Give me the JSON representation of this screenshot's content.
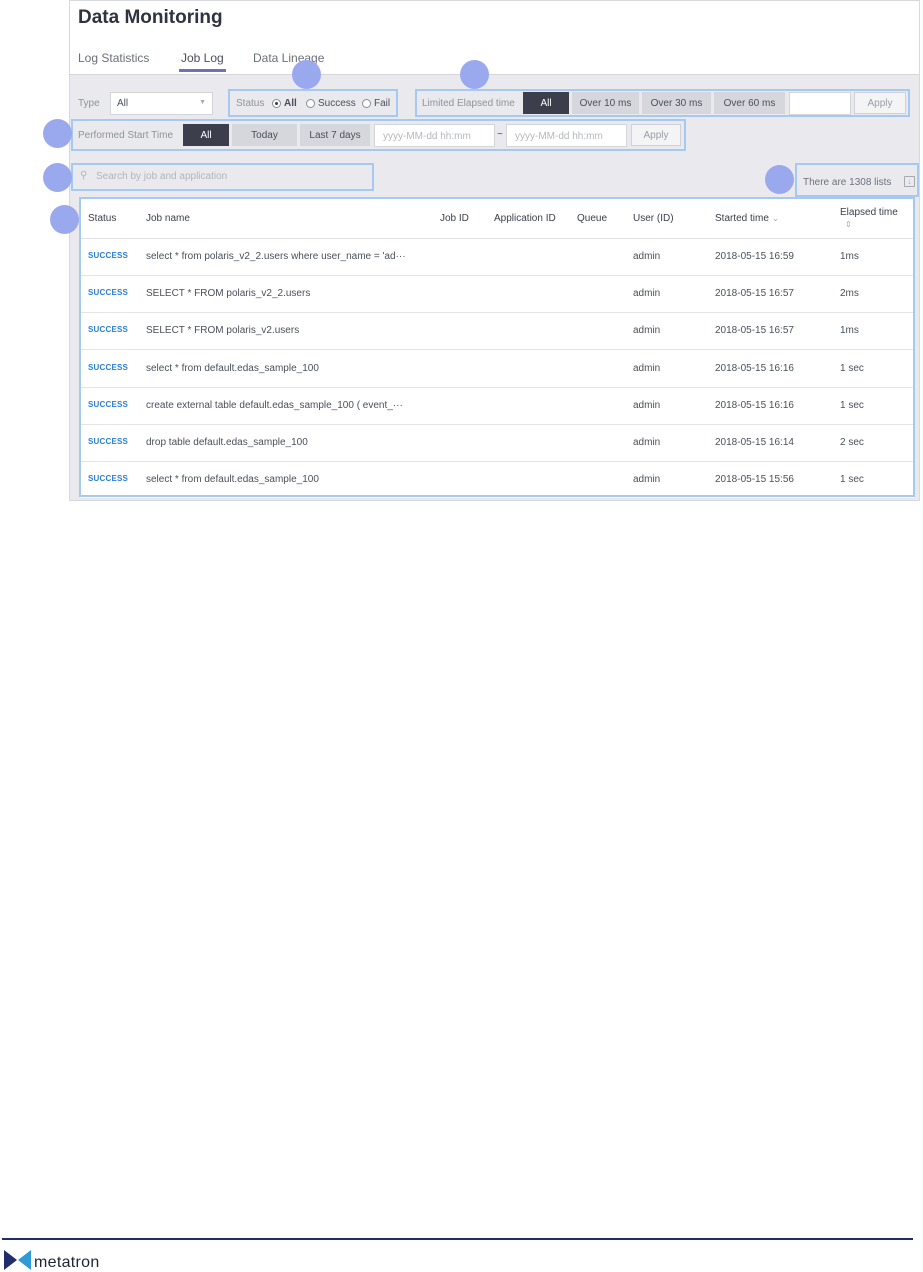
{
  "app": {
    "title": "Data Monitoring"
  },
  "tabs": [
    {
      "label": "Log Statistics",
      "active": false
    },
    {
      "label": "Job Log",
      "active": true
    },
    {
      "label": "Data Lineage",
      "active": false
    }
  ],
  "filters": {
    "type": {
      "label": "Type",
      "value": "All"
    },
    "status": {
      "label": "Status",
      "options": [
        {
          "label": "All",
          "selected": true
        },
        {
          "label": "Success",
          "selected": false
        },
        {
          "label": "Fail",
          "selected": false
        }
      ]
    },
    "elapsed": {
      "label": "Limited Elapsed time",
      "buttons": [
        "All",
        "Over 10 ms",
        "Over 30 ms",
        "Over 60 ms"
      ],
      "selected": "All",
      "custom_value": "",
      "apply_label": "Apply"
    },
    "start_time": {
      "label": "Performed Start Time",
      "buttons": [
        "All",
        "Today",
        "Last 7 days"
      ],
      "selected": "All",
      "from_placeholder": "yyyy-MM-dd hh:mm",
      "separator": "~",
      "to_placeholder": "yyyy-MM-dd hh:mm",
      "apply_label": "Apply"
    }
  },
  "search": {
    "placeholder": "Search by job and application",
    "icon": "search-icon"
  },
  "list_count": "There are 1308 lists",
  "table": {
    "headers": {
      "status": "Status",
      "job_name": "Job name",
      "job_id": "Job ID",
      "application_id": "Application ID",
      "queue": "Queue",
      "user": "User (ID)",
      "started_time": "Started time",
      "elapsed_time": "Elapsed time",
      "sort_down": "⌄",
      "sort_both": "⇕"
    },
    "rows": [
      {
        "status": "SUCCESS",
        "job_name": "select * from polaris_v2_2.users where user_name = 'ad···",
        "job_id": "",
        "application_id": "",
        "queue": "",
        "user": "admin",
        "started_time": "2018-05-15 16:59",
        "elapsed_time": "1ms"
      },
      {
        "status": "SUCCESS",
        "job_name": "SELECT * FROM polaris_v2_2.users",
        "job_id": "",
        "application_id": "",
        "queue": "",
        "user": "admin",
        "started_time": "2018-05-15 16:57",
        "elapsed_time": "2ms"
      },
      {
        "status": "SUCCESS",
        "job_name": "SELECT * FROM polaris_v2.users",
        "job_id": "",
        "application_id": "",
        "queue": "",
        "user": "admin",
        "started_time": "2018-05-15 16:57",
        "elapsed_time": "1ms"
      },
      {
        "status": "SUCCESS",
        "job_name": "select * from default.edas_sample_100",
        "job_id": "",
        "application_id": "",
        "queue": "",
        "user": "admin",
        "started_time": "2018-05-15 16:16",
        "elapsed_time": "1 sec"
      },
      {
        "status": "SUCCESS",
        "job_name": "create external table default.edas_sample_100 ( event_···",
        "job_id": "",
        "application_id": "",
        "queue": "",
        "user": "admin",
        "started_time": "2018-05-15 16:16",
        "elapsed_time": "1 sec"
      },
      {
        "status": "SUCCESS",
        "job_name": "drop table default.edas_sample_100",
        "job_id": "",
        "application_id": "",
        "queue": "",
        "user": "admin",
        "started_time": "2018-05-15 16:14",
        "elapsed_time": "2 sec"
      },
      {
        "status": "SUCCESS",
        "job_name": "select * from default.edas_sample_100",
        "job_id": "",
        "application_id": "",
        "queue": "",
        "user": "admin",
        "started_time": "2018-05-15 15:56",
        "elapsed_time": "1 sec"
      }
    ]
  },
  "colors": {
    "accent": "#6f71b8",
    "status_success": "#2b7fd6",
    "highlight": "#a6c9f1",
    "marker": "#9aa9ee",
    "brand": "#1f2d6b"
  },
  "brand": {
    "name": "metatron"
  }
}
